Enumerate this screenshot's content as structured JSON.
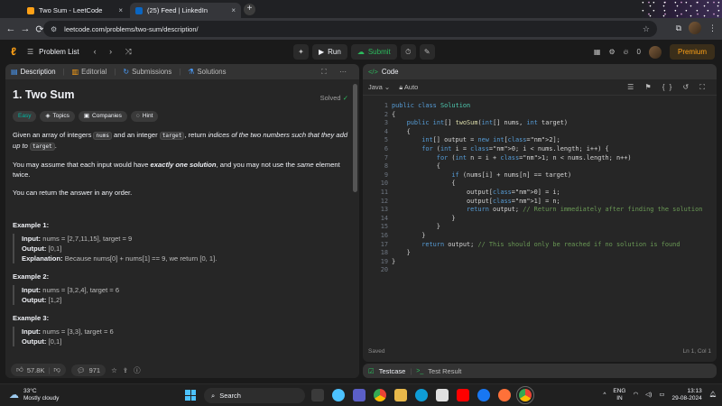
{
  "browser": {
    "tabs": [
      {
        "title": "Two Sum - LeetCode",
        "active": false,
        "favicon_color": "#ffa116"
      },
      {
        "title": "(25) Feed | LinkedIn",
        "active": true,
        "favicon_color": "#0a66c2"
      }
    ],
    "new_tab_label": "+",
    "url": "leetcode.com/problems/two-sum/description/"
  },
  "lc_header": {
    "problem_list_label": "Problem List",
    "run_label": "Run",
    "submit_label": "Submit",
    "notification_count": "0",
    "premium_label": "Premium"
  },
  "left_panel": {
    "tabs": [
      {
        "label": "Description",
        "icon": "description-icon"
      },
      {
        "label": "Editorial",
        "icon": "editorial-icon"
      },
      {
        "label": "Submissions",
        "icon": "submissions-icon"
      },
      {
        "label": "Solutions",
        "icon": "solutions-icon"
      }
    ],
    "title": "1. Two Sum",
    "solved_label": "Solved",
    "tags": {
      "easy": "Easy",
      "topics": "Topics",
      "companies": "Companies",
      "hint": "Hint"
    },
    "desc": {
      "p1_a": "Given an array of integers ",
      "p1_code1": "nums",
      "p1_b": " and an integer ",
      "p1_code2": "target",
      "p1_c": ", return ",
      "p1_em": "indices of the two numbers such that they add up to",
      "p1_code3": "target",
      "p1_d": ".",
      "p2_a": "You may assume that each input would have ",
      "p2_b": "exactly one solution",
      "p2_c": ", and you may not use the ",
      "p2_d": "same",
      "p2_e": " element twice.",
      "p3": "You can return the answer in any order."
    },
    "examples": [
      {
        "heading": "Example 1:",
        "input": "nums = [2,7,11,15], target = 9",
        "output": "[0,1]",
        "explanation": "Because nums[0] + nums[1] == 9, we return [0, 1]."
      },
      {
        "heading": "Example 2:",
        "input": "nums = [3,2,4], target = 6",
        "output": "[1,2]"
      },
      {
        "heading": "Example 3:",
        "input": "nums = [3,3], target = 6",
        "output": "[0,1]"
      }
    ],
    "labels": {
      "input": "Input:",
      "output": "Output:",
      "explanation": "Explanation:"
    },
    "footer": {
      "likes": "57.8K",
      "comments": "971"
    }
  },
  "right_panel": {
    "title": "Code",
    "language": "Java",
    "mode": "Auto",
    "status_left": "Saved",
    "status_right": "Ln 1, Col 1",
    "line_numbers": [
      "1",
      "2",
      "3",
      "4",
      "5",
      "6",
      "7",
      "8",
      "9",
      "10",
      "11",
      "12",
      "13",
      "14",
      "15",
      "16",
      "17",
      "18",
      "19",
      "20"
    ],
    "code_lines": [
      "public class Solution",
      "{",
      "    public int[] twoSum(int[] nums, int target)",
      "    {",
      "        int[] output = new int[2];",
      "        for (int i = 0; i < nums.length; i++) {",
      "            for (int n = i + 1; n < nums.length; n++)",
      "            {",
      "                if (nums[i] + nums[n] == target)",
      "                {",
      "                    output[0] = i;",
      "                    output[1] = n;",
      "                    return output; // Return immediately after finding the solution",
      "                }",
      "            }",
      "        }",
      "        return output; // This should only be reached if no solution is found",
      "    }",
      "}",
      ""
    ],
    "test_tabs": {
      "testcase": "Testcase",
      "result": "Test Result"
    }
  },
  "taskbar": {
    "temperature": "33°C",
    "weather": "Mostly cloudy",
    "search_label": "Search",
    "lang_line1": "ENG",
    "lang_line2": "IN",
    "time": "13:13",
    "date": "29-08-2024"
  },
  "colors": {
    "accent": "#ffa116",
    "success": "#2cbb5d",
    "easy": "#00b8a3"
  }
}
